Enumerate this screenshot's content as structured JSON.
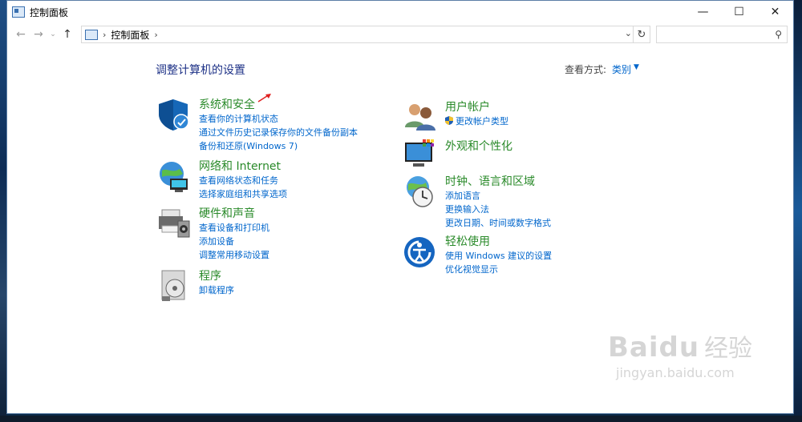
{
  "window": {
    "title": "控制面板"
  },
  "controls": {
    "minimize": "—",
    "maximize": "☐",
    "close": "✕"
  },
  "nav": {
    "back": "←",
    "forward": "→",
    "recent": "⌄",
    "up": "↑"
  },
  "address": {
    "separator": "›",
    "path": "控制面板",
    "trail": "›",
    "dropdown": "⌄",
    "refresh": "↻"
  },
  "search": {
    "placeholder": "",
    "icon": "⚲"
  },
  "header": {
    "title": "调整计算机的设置",
    "view_by_label": "查看方式:",
    "view_by_value": "类别",
    "caret": "▼"
  },
  "categories": [
    {
      "title": "系统和安全",
      "icon": "shield-icon",
      "links": [
        "查看你的计算机状态",
        "通过文件历史记录保存你的文件备份副本",
        "备份和还原(Windows 7)"
      ]
    },
    {
      "title": "网络和 Internet",
      "icon": "network-globe-icon",
      "links": [
        "查看网络状态和任务",
        "选择家庭组和共享选项"
      ]
    },
    {
      "title": "硬件和声音",
      "icon": "printer-speaker-icon",
      "links": [
        "查看设备和打印机",
        "添加设备",
        "调整常用移动设置"
      ]
    },
    {
      "title": "程序",
      "icon": "programs-disc-icon",
      "links": [
        "卸载程序"
      ]
    },
    {
      "title": "用户帐户",
      "icon": "users-icon",
      "links": [
        "更改帐户类型"
      ]
    },
    {
      "title": "外观和个性化",
      "icon": "monitor-palette-icon",
      "links": []
    },
    {
      "title": "时钟、语言和区域",
      "icon": "clock-globe-icon",
      "links": [
        "添加语言",
        "更换输入法",
        "更改日期、时间或数字格式"
      ]
    },
    {
      "title": "轻松使用",
      "icon": "ease-of-access-icon",
      "links": [
        "使用 Windows 建议的设置",
        "优化视觉显示"
      ]
    }
  ],
  "watermark": {
    "brand": "Bai",
    "brand2": "du",
    "cn": "经验",
    "url": "jingyan.baidu.com"
  },
  "colors": {
    "link": "#0066cc",
    "category_title": "#2a8a2a",
    "page_title": "#1e3287"
  }
}
